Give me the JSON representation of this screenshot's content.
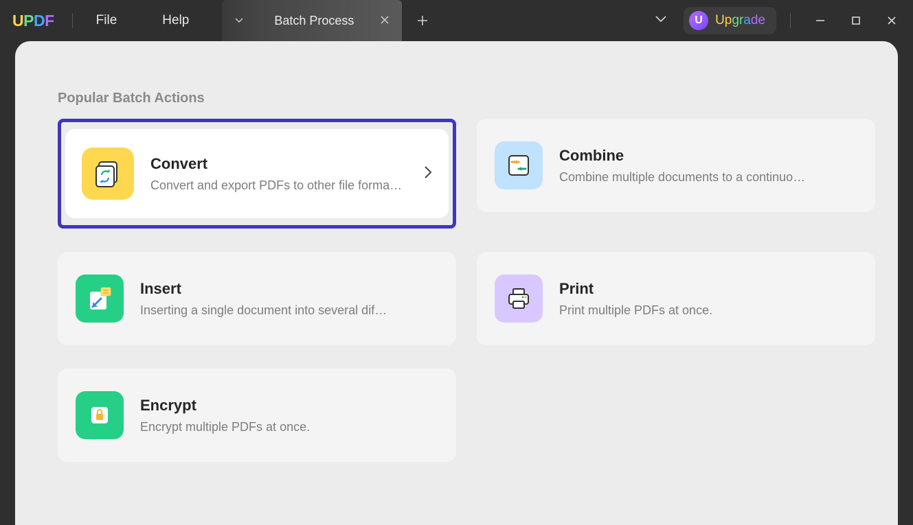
{
  "app": {
    "logo": "UPDF"
  },
  "menu": {
    "file": "File",
    "help": "Help"
  },
  "tab": {
    "title": "Batch Process"
  },
  "upgrade": {
    "letter": "U",
    "label": "Upgrade"
  },
  "section": {
    "title": "Popular Batch Actions"
  },
  "cards": {
    "convert": {
      "title": "Convert",
      "desc": "Convert and export PDFs to other file forma…"
    },
    "combine": {
      "title": "Combine",
      "desc": "Combine multiple documents to a continuo…"
    },
    "insert": {
      "title": "Insert",
      "desc": "Inserting a single document into several dif…"
    },
    "print": {
      "title": "Print",
      "desc": "Print multiple PDFs at once."
    },
    "encrypt": {
      "title": "Encrypt",
      "desc": "Encrypt multiple PDFs at once."
    }
  }
}
